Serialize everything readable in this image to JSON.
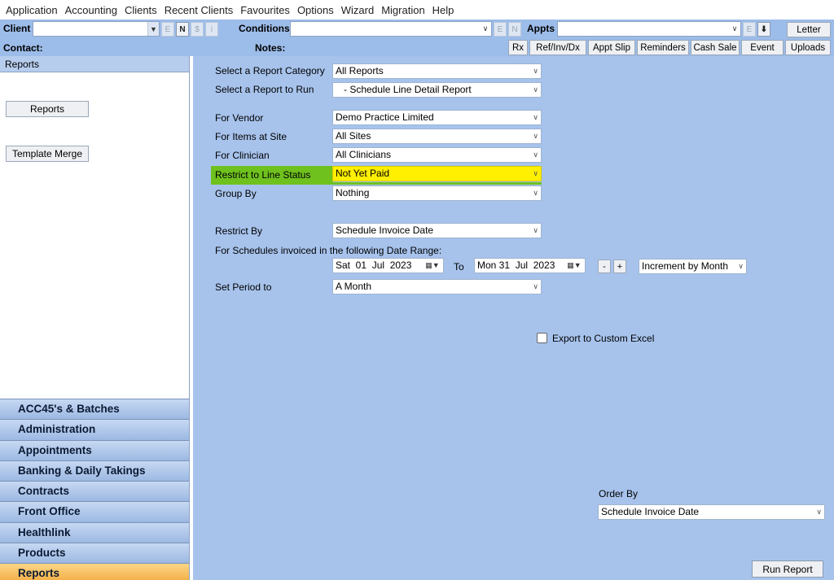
{
  "menu": [
    "Application",
    "Accounting",
    "Clients",
    "Recent Clients",
    "Favourites",
    "Options",
    "Wizard",
    "Migration",
    "Help"
  ],
  "toolbar": {
    "client_label": "Client",
    "conditions_label": "Conditions",
    "appts_label": "Appts",
    "contact_label": "Contact:",
    "notes_label": "Notes:",
    "client_btns": [
      "E",
      "N",
      "$",
      "i"
    ],
    "cond_btns": [
      "E",
      "N"
    ],
    "appt_btns": [
      "E",
      "⬇"
    ],
    "letter_label": "Letter",
    "row2_buttons": [
      "Rx",
      "Ref/Inv/Dx",
      "Appt Slip",
      "Reminders",
      "Cash Sale",
      "Event",
      "Uploads"
    ]
  },
  "left": {
    "header": "Reports",
    "reports_btn": "Reports",
    "template_btn": "Template Merge",
    "nav": [
      "ACC45's & Batches",
      "Administration",
      "Appointments",
      "Banking & Daily Takings",
      "Contracts",
      "Front Office",
      "Healthlink",
      "Products",
      "Reports"
    ]
  },
  "form": {
    "category_label": "Select a Report Category",
    "category_value": "All Reports",
    "report_label": "Select a Report to Run",
    "report_value": "   - Schedule Line Detail Report",
    "vendor_label": "For Vendor",
    "vendor_value": "Demo Practice Limited",
    "items_label": "For Items at Site",
    "items_value": "All Sites",
    "clinician_label": "For Clinician",
    "clinician_value": "All Clinicians",
    "status_label": "Restrict to Line Status",
    "status_value": "Not Yet Paid",
    "group_label": "Group By",
    "group_value": "Nothing",
    "restrict_label": "Restrict By",
    "restrict_value": "Schedule Invoice Date",
    "range_label": "For Schedules invoiced in the following Date Range:",
    "date_from": "Sat  01  Jul  2023",
    "to_label": "To",
    "date_to": "Mon 31  Jul  2023",
    "minus": "-",
    "plus": "+",
    "increment_value": "Increment by Month",
    "period_label": "Set Period to",
    "period_value": "A Month",
    "export_label": "Export to Custom Excel",
    "order_label": "Order By",
    "order_value": "Schedule Invoice Date",
    "run_label": "Run Report"
  },
  "colors": {
    "toolbar_bg": "#9cbce9",
    "main_bg": "#a7c3ec",
    "highlight_green": "#6fc11e",
    "highlight_yellow": "#ffef00",
    "nav_selected": "#f2a83b"
  }
}
